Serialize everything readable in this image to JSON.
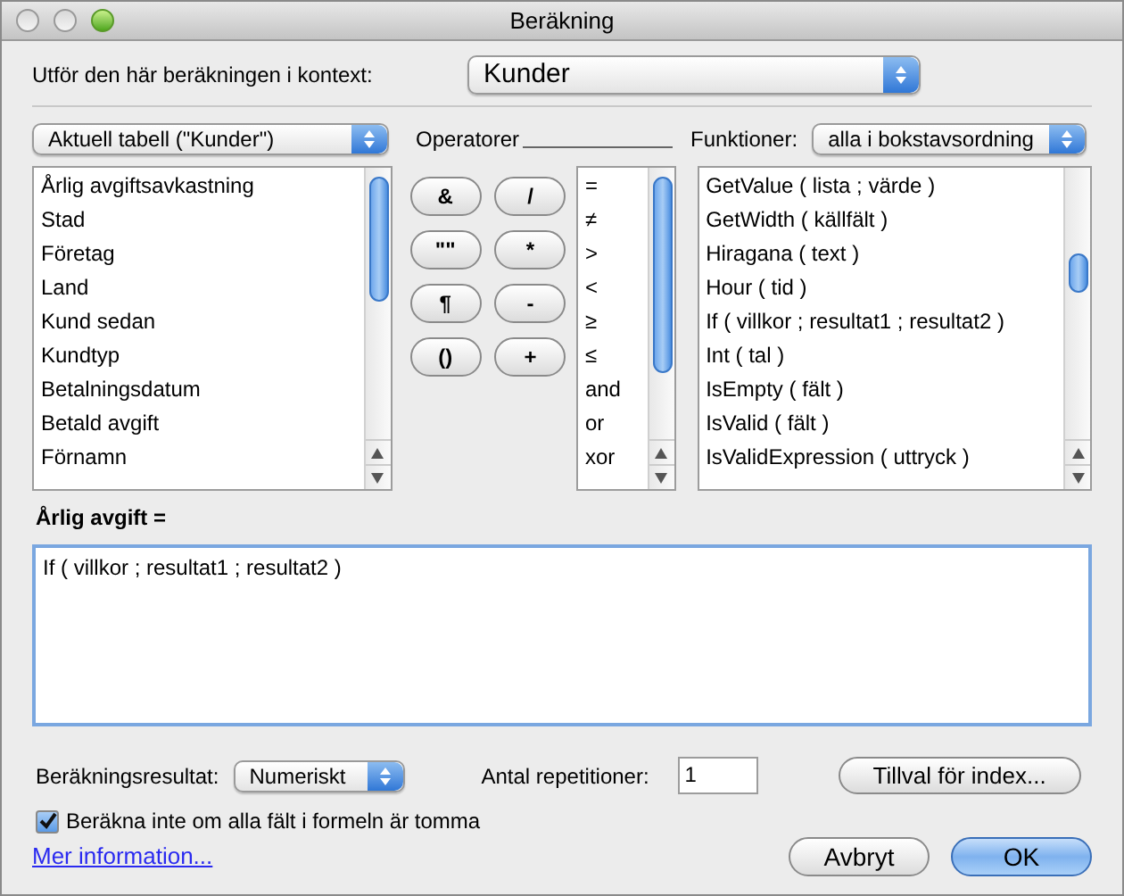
{
  "window": {
    "title": "Beräkning"
  },
  "context": {
    "label": "Utför den här beräkningen i kontext:",
    "value": "Kunder"
  },
  "table_popup": {
    "value": "Aktuell tabell (\"Kunder\")"
  },
  "operators_label": "Operatorer",
  "functions_label": "Funktioner:",
  "functions_popup": {
    "value": "alla i bokstavsordning"
  },
  "fields": [
    "Årlig avgiftsavkastning",
    "Stad",
    "Företag",
    "Land",
    "Kund sedan",
    "Kundtyp",
    "Betalningsdatum",
    "Betald avgift",
    "Förnamn"
  ],
  "operator_buttons": [
    "&",
    "/",
    "\"\"",
    "*",
    "¶",
    "-",
    "()",
    "+"
  ],
  "operators": [
    "=",
    "≠",
    ">",
    "<",
    "≥",
    "≤",
    "and",
    "or",
    "xor"
  ],
  "functions": [
    "GetValue ( lista ; värde )",
    "GetWidth ( källfält )",
    "Hiragana ( text )",
    "Hour ( tid )",
    "If ( villkor ; resultat1 ; resultat2 )",
    "Int ( tal )",
    "IsEmpty ( fält )",
    "IsValid ( fält )",
    "IsValidExpression ( uttryck )"
  ],
  "formula": {
    "label": "Årlig avgift =",
    "value": "If ( villkor ; resultat1 ; resultat2 )"
  },
  "result": {
    "label": "Beräkningsresultat:",
    "value": "Numeriskt"
  },
  "repetitions": {
    "label": "Antal repetitioner:",
    "value": "1"
  },
  "index_button": "Tillval för index...",
  "skip_empty": {
    "label": "Beräkna inte om alla fält i formeln är tomma",
    "checked": true
  },
  "buttons": [
    {
      "label": "Avbryt",
      "default": false
    },
    {
      "label": "OK",
      "default": true
    }
  ],
  "link": "Mer information..."
}
